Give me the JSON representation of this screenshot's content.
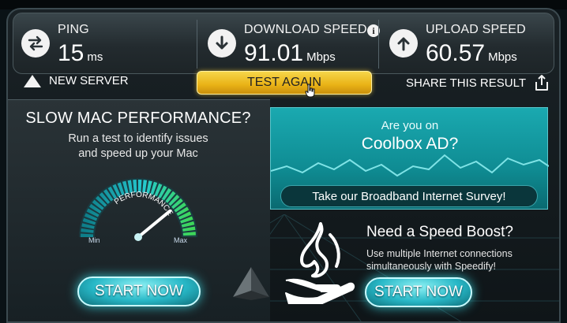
{
  "stats": {
    "ping": {
      "label": "PING",
      "value": "15",
      "unit": "ms"
    },
    "download": {
      "label": "DOWNLOAD SPEED",
      "value": "91.01",
      "unit": "Mbps"
    },
    "upload": {
      "label": "UPLOAD SPEED",
      "value": "60.57",
      "unit": "Mbps"
    }
  },
  "actions": {
    "new_server": "NEW SERVER",
    "test_again": "TEST AGAIN",
    "share": "SHARE THIS RESULT"
  },
  "mac_panel": {
    "title": "SLOW MAC PERFORMANCE?",
    "subtitle_line1": "Run a test to identify issues",
    "subtitle_line2": "and speed up your Mac",
    "gauge_label": "PERFORMANCE",
    "gauge_min": "Min",
    "gauge_max": "Max",
    "gauge_level": 0.78,
    "button": "START NOW"
  },
  "survey": {
    "question": "Are you on",
    "isp": "Coolbox AD?",
    "button": "Take our Broadband Internet Survey!"
  },
  "boost": {
    "title": "Need a Speed Boost?",
    "desc_line1": "Use multiple Internet connections",
    "desc_line2": "simultaneously with Speedify!",
    "button": "START NOW"
  },
  "colors": {
    "accent_teal": "#1aa9b0",
    "button_yellow": "#e9b216",
    "gauge_green": "#3dd65a"
  }
}
